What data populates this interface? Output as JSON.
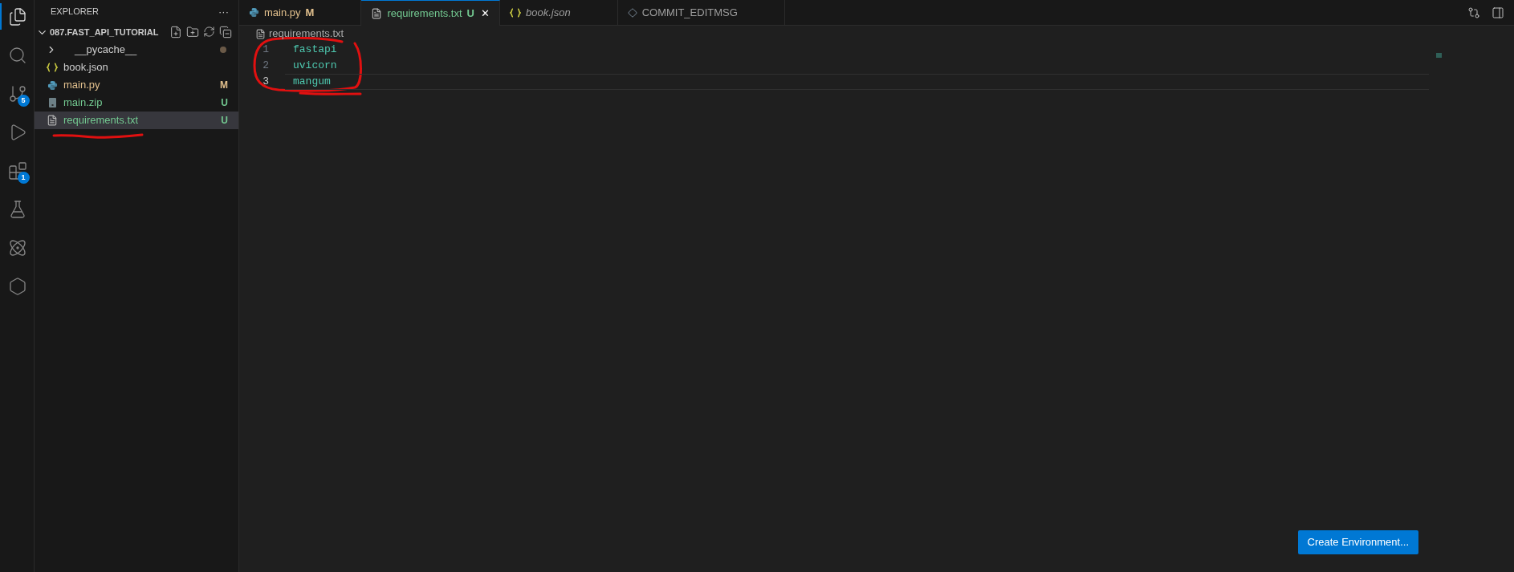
{
  "activity_bar": [
    {
      "kind": "files",
      "selected": true
    },
    {
      "kind": "search",
      "selected": false
    },
    {
      "kind": "source-control",
      "selected": false,
      "badge": "5"
    },
    {
      "kind": "run",
      "selected": false
    },
    {
      "kind": "extensions",
      "selected": false,
      "badge": "1"
    },
    {
      "kind": "flask",
      "selected": false
    },
    {
      "kind": "atom",
      "selected": false
    },
    {
      "kind": "knot",
      "selected": false
    }
  ],
  "explorer": {
    "title": "EXPLORER",
    "menu": "···",
    "folder": {
      "name": "087.FAST_API_TUTORIAL",
      "expanded": true
    },
    "items": [
      {
        "kind": "folder",
        "name": "__pycache__",
        "expanded": false,
        "status_dot": true,
        "color": "#6b5a48",
        "selected": false
      },
      {
        "kind": "json",
        "name": "book.json",
        "selected": false
      },
      {
        "kind": "python",
        "name": "main.py",
        "status": "M",
        "color": "#e2c08d",
        "selected": false
      },
      {
        "kind": "zip",
        "name": "main.zip",
        "status": "U",
        "color": "#73c991",
        "selected": false
      },
      {
        "kind": "text",
        "name": "requirements.txt",
        "status": "U",
        "color": "#73c991",
        "selected": true
      }
    ]
  },
  "tabs": [
    {
      "kind": "python",
      "label": "main.py",
      "status": "M",
      "color": "#e2c08d",
      "selected": false,
      "preview": false
    },
    {
      "kind": "text",
      "label": "requirements.txt",
      "status": "U",
      "color": "#73c991",
      "selected": true,
      "preview": false,
      "close": "✕"
    },
    {
      "kind": "json",
      "label": "book.json",
      "selected": false,
      "preview": true
    },
    {
      "kind": "git",
      "label": "COMMIT_EDITMSG",
      "selected": false,
      "preview": false
    }
  ],
  "breadcrumb": "requirements.txt",
  "code_lines": [
    {
      "number": "1",
      "text": "fastapi",
      "current": false
    },
    {
      "number": "2",
      "text": "uvicorn",
      "current": false
    },
    {
      "number": "3",
      "text": "mangum",
      "current": true
    }
  ],
  "button": "Create Environment..."
}
